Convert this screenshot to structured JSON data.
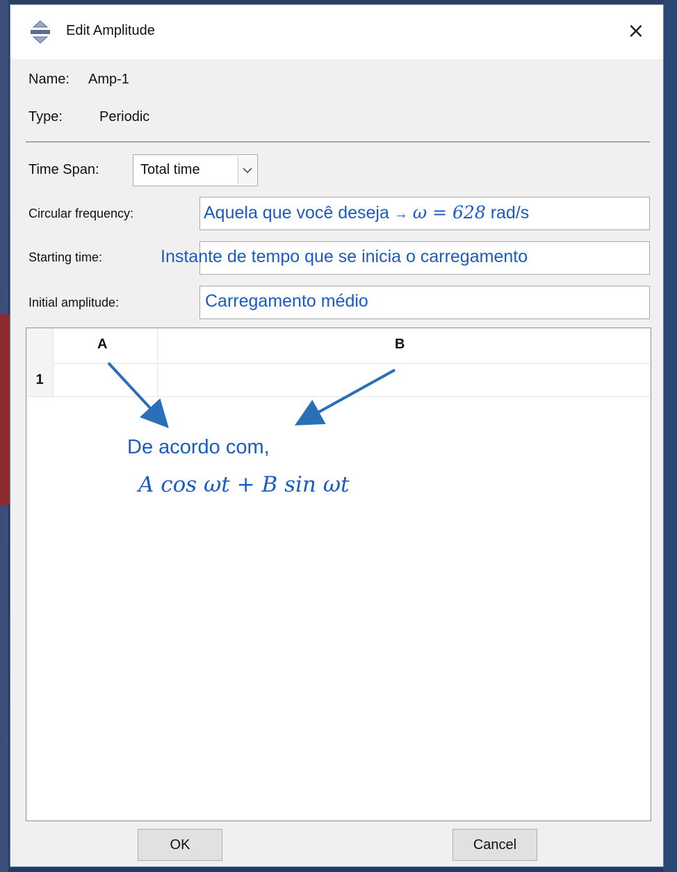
{
  "dialog": {
    "title": "Edit Amplitude",
    "close_symbol": "×",
    "icon": "amplitude-app-icon"
  },
  "info": {
    "name_label": "Name:",
    "name_value": "Amp-1",
    "type_label": "Type:",
    "type_value": "Periodic"
  },
  "form": {
    "time_span_label": "Time Span:",
    "time_span_value": "Total time",
    "circular_frequency_label": "Circular frequency:",
    "starting_time_label": "Starting time:",
    "initial_amplitude_label": "Initial amplitude:"
  },
  "annotations": {
    "circular_frequency_text": "Aquela que você deseja",
    "circular_frequency_arrow": "→",
    "circular_frequency_formula": "ω = 628",
    "circular_frequency_unit": "rad/s",
    "starting_time_text": "Instante de tempo que se inicia o carregamento",
    "initial_amplitude_text": "Carregamento médio",
    "table_note_line1": "De acordo com,",
    "table_note_formula": "A cos ωt + B sin ωt"
  },
  "table": {
    "columns": [
      "A",
      "B"
    ],
    "rows": [
      {
        "index": "1",
        "A": "",
        "B": ""
      }
    ]
  },
  "buttons": {
    "ok": "OK",
    "cancel": "Cancel"
  },
  "colors": {
    "annotation": "#1a5bc4",
    "dialog_bg": "#f0f0f0",
    "desktop_bg": "#1f3158"
  }
}
